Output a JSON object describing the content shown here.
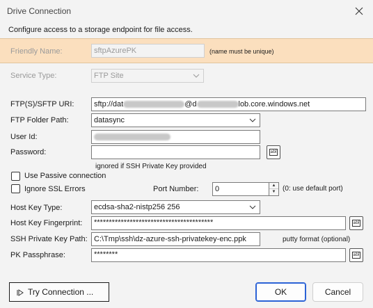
{
  "window": {
    "title": "Drive Connection",
    "description": "Configure access to a storage endpoint for file access."
  },
  "friendly_name": {
    "label": "Friendly Name:",
    "value": "sftpAzurePK",
    "hint": "(name must be unique)"
  },
  "service_type": {
    "label": "Service Type:",
    "value": "FTP Site"
  },
  "uri": {
    "label": "FTP(S)/SFTP URI:",
    "value_start": "sftp://dat",
    "value_mid": "@d",
    "value_end": "lob.core.windows.net"
  },
  "folder_path": {
    "label": "FTP Folder Path:",
    "value": "datasync"
  },
  "user_id": {
    "label": "User Id:"
  },
  "password": {
    "label": "Password:",
    "note": "ignored if SSH Private Key provided",
    "show_button": "abl"
  },
  "passive": {
    "label": "Use Passive connection",
    "checked": false
  },
  "ignore_ssl": {
    "label": "Ignore SSL Errors",
    "checked": false
  },
  "port": {
    "label": "Port Number:",
    "value": "0",
    "hint": "(0: use default port)"
  },
  "host_key_type": {
    "label": "Host Key Type:",
    "value": "ecdsa-sha2-nistp256 256"
  },
  "host_key_fingerprint": {
    "label": "Host Key Fingerprint:",
    "value": "****************************************",
    "show_button": "abl"
  },
  "ssh_key_path": {
    "label": "SSH Private Key Path:",
    "value": "C:\\Tmp\\ssh\\dz-azure-ssh-privatekey-enc.ppk",
    "hint": "putty format (optional)"
  },
  "pk_passphrase": {
    "label": "PK Passphrase:",
    "value": "********",
    "show_button": "abl"
  },
  "buttons": {
    "try": "Try Connection ...",
    "ok": "OK",
    "cancel": "Cancel"
  },
  "icons": [
    "close-icon",
    "chevron-down-icon",
    "play-icon",
    "spin-up-icon",
    "spin-down-icon"
  ],
  "colors": {
    "name_band": "#fbdfbe",
    "ok_border": "#2b62d6"
  }
}
